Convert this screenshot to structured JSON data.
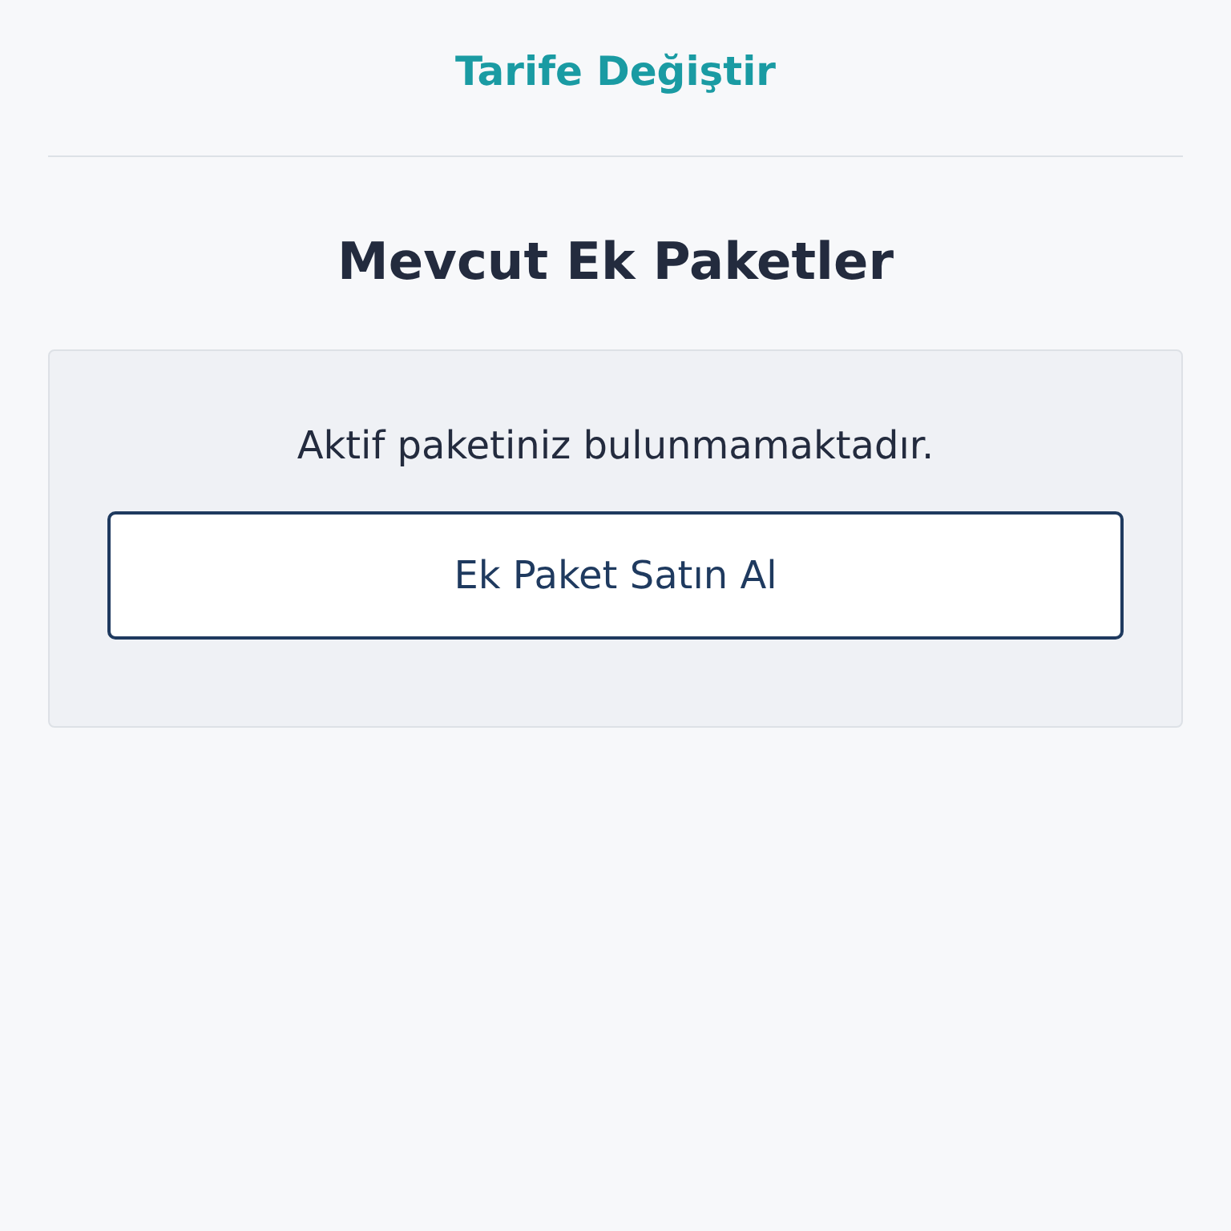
{
  "header_link": {
    "label": "Tarife Değiştir"
  },
  "section": {
    "title": "Mevcut Ek Paketler",
    "message": "Aktif paketiniz bulunmamaktadır.",
    "button": "Ek Paket Satın Al"
  }
}
